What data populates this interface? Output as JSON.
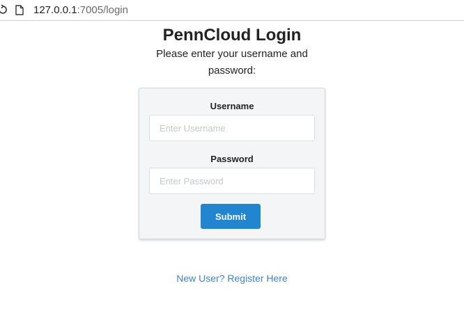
{
  "browser": {
    "url_host": "127.0.0.1",
    "url_rest": ":7005/login"
  },
  "page": {
    "title": "PennCloud Login",
    "subtitle": "Please enter your username and password:"
  },
  "form": {
    "username_label": "Username",
    "username_placeholder": "Enter Username",
    "username_value": "",
    "password_label": "Password",
    "password_placeholder": "Enter Password",
    "password_value": "",
    "submit_label": "Submit"
  },
  "register_link": {
    "label": "New User? Register Here"
  },
  "colors": {
    "primary_button": "#2185d0",
    "link": "#4183c4",
    "card_background": "#f4f5f6"
  },
  "icons": [
    "reload-icon",
    "page-icon"
  ]
}
